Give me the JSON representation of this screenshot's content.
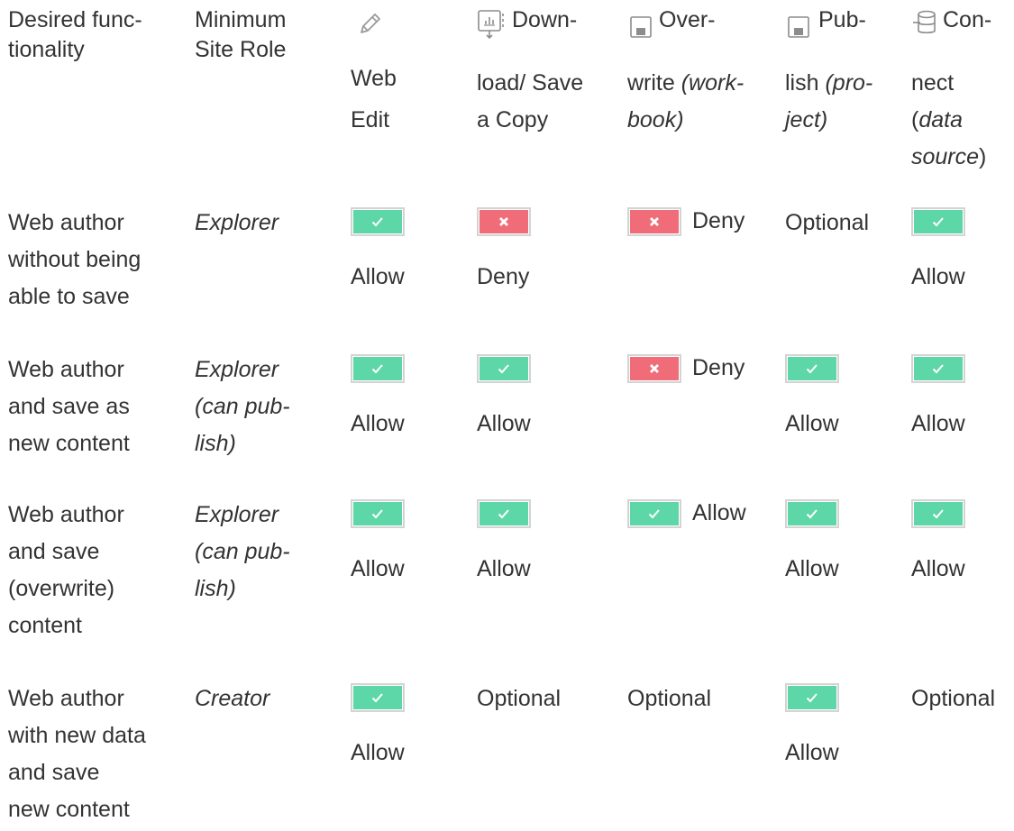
{
  "header": {
    "desired": [
      "Desired func-",
      "tionality"
    ],
    "minrole": [
      "Minimum",
      "Site Role"
    ],
    "webedit": [
      "Web",
      "Edit"
    ],
    "download": [
      "Down-",
      "load/ Save",
      "a Copy"
    ],
    "overwrite": [
      "Over-",
      "write ",
      "(work-",
      "book)"
    ],
    "publish": [
      "Pub-",
      "lish ",
      "(pro-",
      "ject)"
    ],
    "connect": [
      "Con-",
      "nect",
      "(",
      "data",
      "source",
      ")"
    ]
  },
  "rows": [
    {
      "desired": [
        "Web author",
        "without being",
        "able to save"
      ],
      "role": [
        "Explorer"
      ],
      "webedit": "Allow",
      "download": "Deny",
      "overwrite": "Deny",
      "publish": "Optional",
      "connect": "Allow"
    },
    {
      "desired": [
        "Web author",
        "and save as",
        "new content"
      ],
      "role": [
        "Explorer",
        "(can pub-",
        "lish)"
      ],
      "webedit": "Allow",
      "download": "Allow",
      "overwrite": "Deny",
      "publish": "Allow",
      "connect": "Allow"
    },
    {
      "desired": [
        "Web author",
        "and save",
        "(overwrite)",
        "content"
      ],
      "role": [
        "Explorer",
        "(can pub-",
        "lish)"
      ],
      "webedit": "Allow",
      "download": "Allow",
      "overwrite": "Allow",
      "publish": "Allow",
      "connect": "Allow"
    },
    {
      "desired": [
        "Web author",
        "with new data",
        "and save",
        "new content"
      ],
      "role": [
        "Creator"
      ],
      "webedit": "Allow",
      "download": "Optional",
      "overwrite": "Optional",
      "publish": "Allow",
      "connect": "Optional"
    }
  ],
  "icons": {
    "webedit": "pencil-icon",
    "download": "download-icon",
    "overwrite": "save-icon",
    "publish": "save-icon",
    "connect": "database-icon"
  },
  "colors": {
    "allow": "#5dd6a8",
    "deny": "#ef6c78",
    "text": "#333333"
  }
}
